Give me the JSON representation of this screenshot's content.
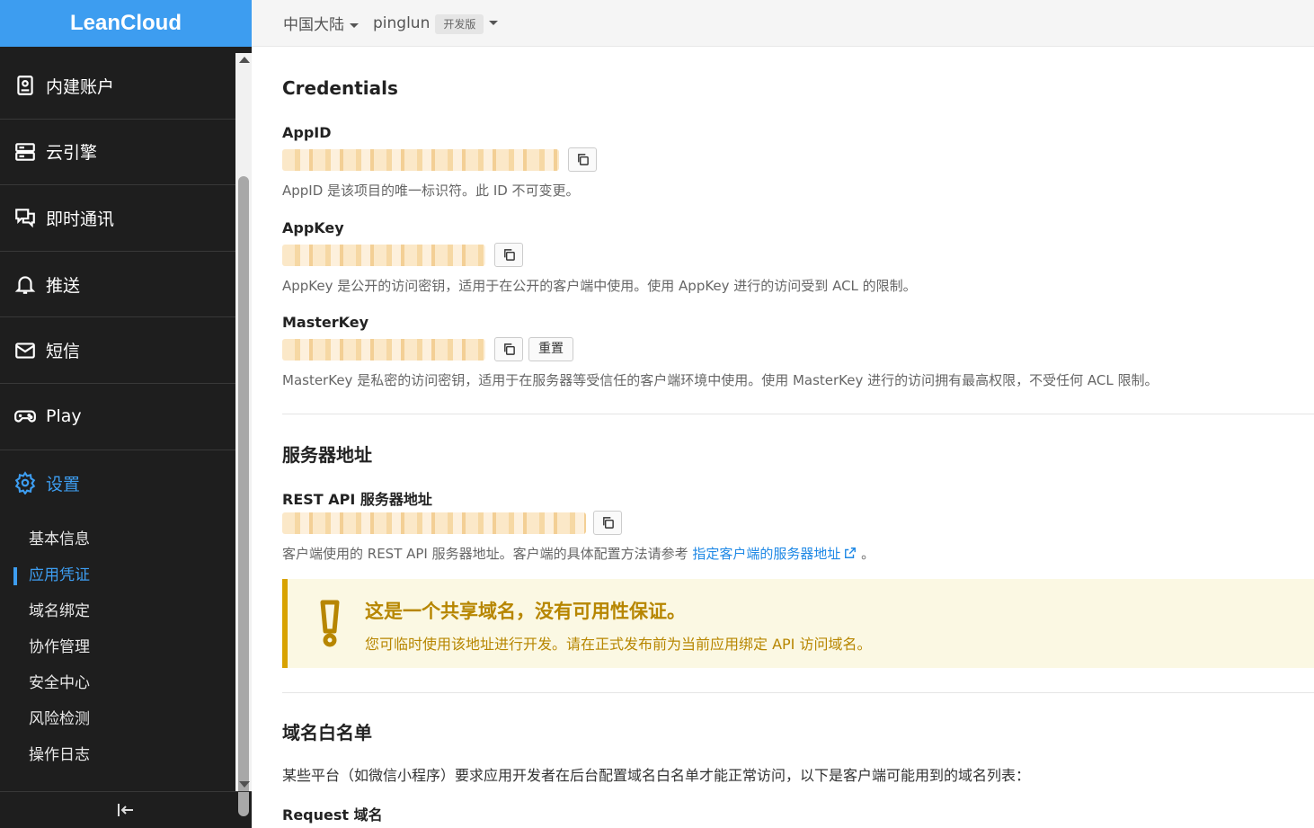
{
  "brand": {
    "name": "LeanCloud"
  },
  "topbar": {
    "region": "中国大陆",
    "app_name": "pinglun",
    "plan_badge": "开发版"
  },
  "sidebar": {
    "nav": [
      {
        "label": "内建账户",
        "icon": "account-icon"
      },
      {
        "label": "云引擎",
        "icon": "server-icon"
      },
      {
        "label": "即时通讯",
        "icon": "chat-icon"
      },
      {
        "label": "推送",
        "icon": "bell-icon"
      },
      {
        "label": "短信",
        "icon": "mail-icon"
      },
      {
        "label": "Play",
        "icon": "gamepad-icon"
      },
      {
        "label": "设置",
        "icon": "gear-icon",
        "active": true
      }
    ],
    "sub_items": [
      {
        "label": "基本信息"
      },
      {
        "label": "应用凭证",
        "active": true
      },
      {
        "label": "域名绑定"
      },
      {
        "label": "协作管理"
      },
      {
        "label": "安全中心"
      },
      {
        "label": "风险检测"
      },
      {
        "label": "操作日志"
      }
    ],
    "collapse_icon": "collapse-left-icon"
  },
  "credentials": {
    "title": "Credentials",
    "appid": {
      "label": "AppID",
      "help": "AppID 是该项目的唯一标识符。此 ID 不可变更。"
    },
    "appkey": {
      "label": "AppKey",
      "help": "AppKey 是公开的访问密钥，适用于在公开的客户端中使用。使用 AppKey 进行的访问受到 ACL 的限制。"
    },
    "masterkey": {
      "label": "MasterKey",
      "reset_label": "重置",
      "help": "MasterKey 是私密的访问密钥，适用于在服务器等受信任的客户端环境中使用。使用 MasterKey 进行的访问拥有最高权限，不受任何 ACL 限制。"
    }
  },
  "server": {
    "title": "服务器地址",
    "rest_label": "REST API 服务器地址",
    "help_prefix": "客户端使用的 REST API 服务器地址。客户端的具体配置方法请参考 ",
    "help_link": "指定客户端的服务器地址",
    "help_suffix": " 。",
    "warning_title": "这是一个共享域名，没有可用性保证。",
    "warning_body": "您可临时使用该地址进行开发。请在正式发布前为当前应用绑定 API 访问域名。"
  },
  "whitelist": {
    "title": "域名白名单",
    "desc": "某些平台（如微信小程序）要求应用开发者在后台配置域名白名单才能正常访问，以下是客户端可能用到的域名列表：",
    "request_label": "Request 域名"
  },
  "colors": {
    "accent": "#3d9df0",
    "warning": "#b78600",
    "sidebar_bg": "#1e1e1e"
  }
}
